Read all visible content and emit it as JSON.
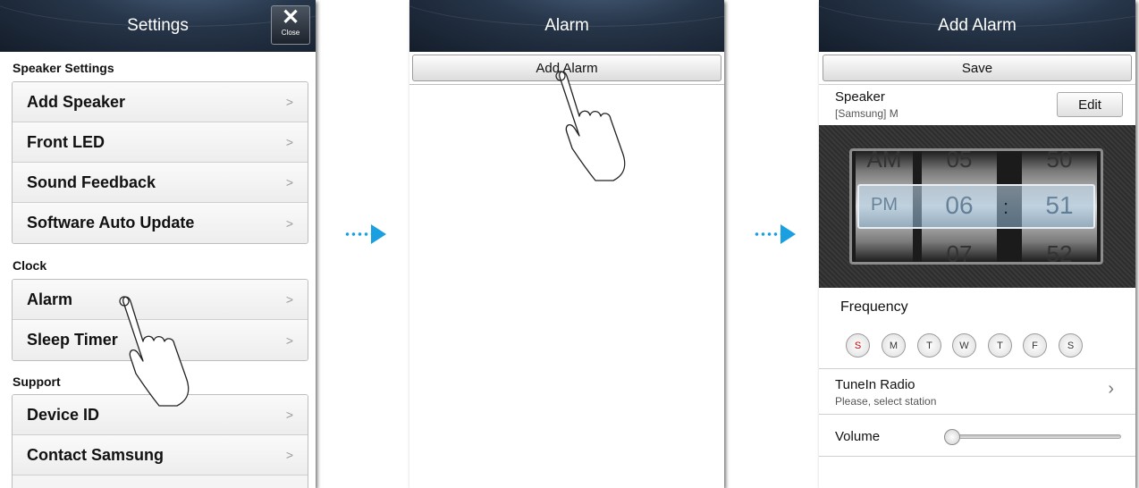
{
  "settings": {
    "title": "Settings",
    "close_icon": "close-icon",
    "close_label": "Close",
    "speaker_settings_heading": "Speaker Settings",
    "speaker_items": [
      "Add Speaker",
      "Front LED",
      "Sound Feedback",
      "Software Auto Update"
    ],
    "clock_heading": "Clock",
    "clock_items": [
      "Alarm",
      "Sleep Timer"
    ],
    "support_heading": "Support",
    "support_items": [
      "Device ID",
      "Contact Samsung"
    ],
    "chevron": ">"
  },
  "alarm": {
    "title": "Alarm",
    "add_button": "Add Alarm"
  },
  "add_alarm": {
    "title": "Add Alarm",
    "save_button": "Save",
    "speaker_label": "Speaker",
    "speaker_value": "[Samsung] M",
    "edit_button": "Edit",
    "picker": {
      "ampm": {
        "above": "AM",
        "selected": "PM",
        "below": ""
      },
      "hour": {
        "above": "05",
        "selected": "06",
        "below": "07"
      },
      "minute": {
        "above": "50",
        "selected": "51",
        "below": "52"
      },
      "separator": ":"
    },
    "frequency_label": "Frequency",
    "days": [
      "S",
      "M",
      "T",
      "W",
      "T",
      "F",
      "S"
    ],
    "sunday_color": "#d00000",
    "source_title": "TuneIn Radio",
    "source_sub": "Please, select station",
    "source_chevron": "›",
    "volume_label": "Volume",
    "volume_level": 0
  },
  "colors": {
    "accent_arrow": "#1aa0e0",
    "titlebar": "#1e2a3a"
  }
}
